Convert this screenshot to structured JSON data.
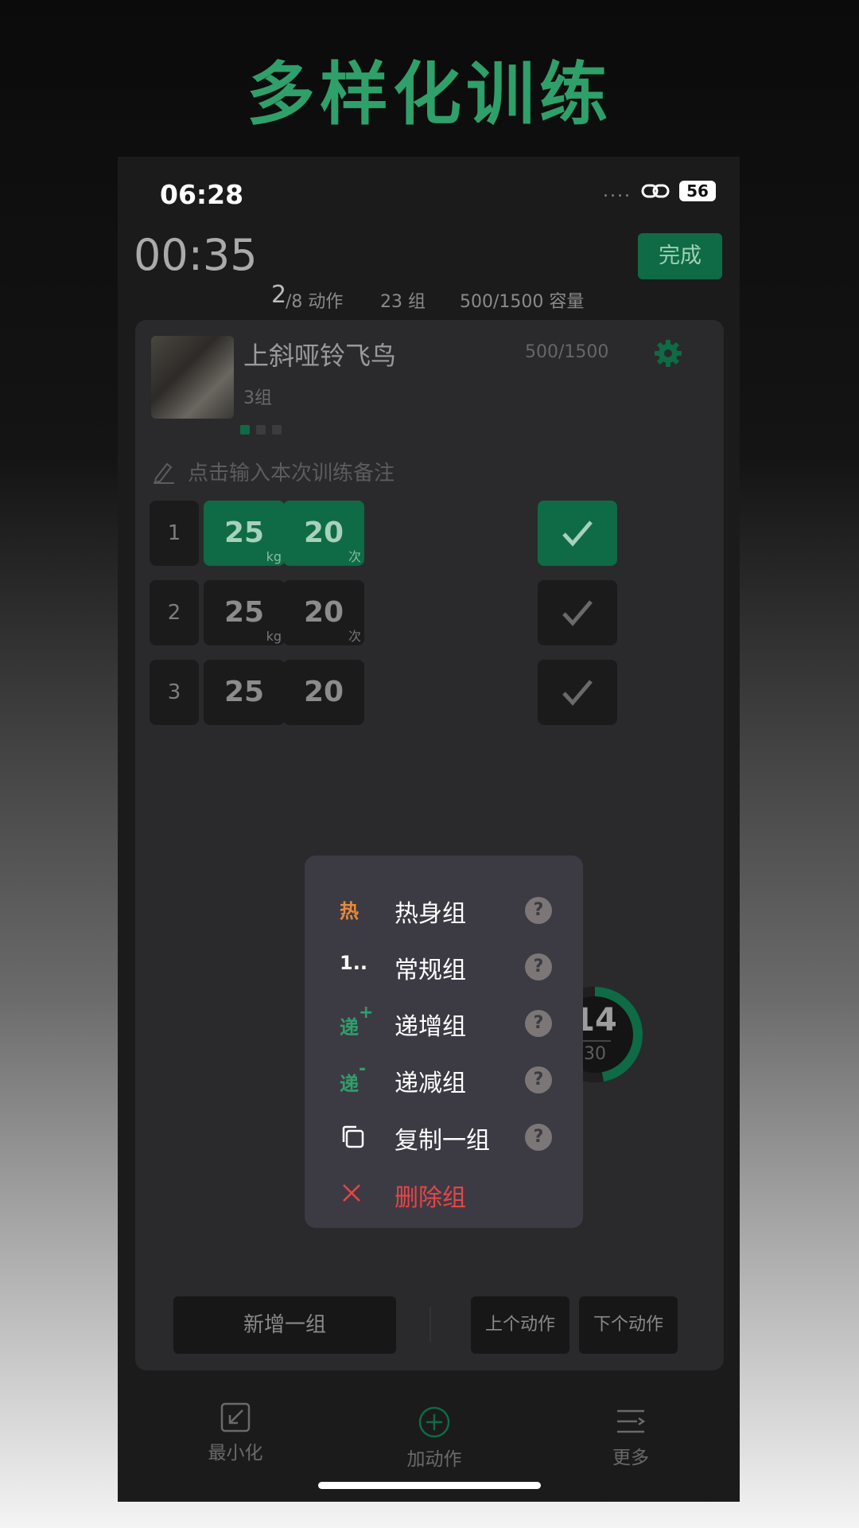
{
  "headline": "多样化训练",
  "status": {
    "time": "06:28",
    "signal_dots": "....",
    "battery": "56"
  },
  "header": {
    "timer": "00:35",
    "done_label": "完成"
  },
  "summary": {
    "exercise_index": "2",
    "exercise_total": "/8 动作",
    "sets": "23 组",
    "volume": "500/1500 容量"
  },
  "exercise": {
    "name": "上斜哑铃飞鸟",
    "volume": "500/1500",
    "sets_label": "3组",
    "note_placeholder": "点击输入本次训练备注"
  },
  "sets": [
    {
      "index": "1",
      "weight": "25",
      "weight_unit": "kg",
      "reps": "20",
      "reps_unit": "次",
      "done": true
    },
    {
      "index": "2",
      "weight": "25",
      "weight_unit": "kg",
      "reps": "20",
      "reps_unit": "次",
      "done": false
    },
    {
      "index": "3",
      "weight": "25",
      "reps": "20",
      "done": false
    }
  ],
  "rest_timer": {
    "current": "14",
    "total": "30",
    "progress": 0.47
  },
  "buttons": {
    "add_set": "新增一组",
    "prev_exercise": "上个动作",
    "next_exercise": "下个动作"
  },
  "tabbar": [
    {
      "label": "最小化",
      "icon": "minimize-icon"
    },
    {
      "label": "加动作",
      "icon": "add-circle-icon"
    },
    {
      "label": "更多",
      "icon": "more-menu-icon"
    }
  ],
  "menu": [
    {
      "icon_text": "热",
      "label": "热身组",
      "color": "#e88a3a"
    },
    {
      "icon_text": "1..",
      "label": "常规组",
      "color": "#ffffff"
    },
    {
      "icon_text": "递",
      "badge": "+",
      "label": "递增组",
      "color": "#2fa06a"
    },
    {
      "icon_text": "递",
      "badge": "-",
      "label": "递减组",
      "color": "#2fa06a"
    },
    {
      "icon": "copy-icon",
      "label": "复制一组"
    },
    {
      "icon": "close-icon",
      "label": "删除组",
      "color": "#e84545"
    }
  ],
  "help_glyph": "?",
  "colors": {
    "accent": "#0e6b45",
    "headline": "#2fa06a",
    "danger": "#e84545",
    "warm": "#e88a3a"
  }
}
